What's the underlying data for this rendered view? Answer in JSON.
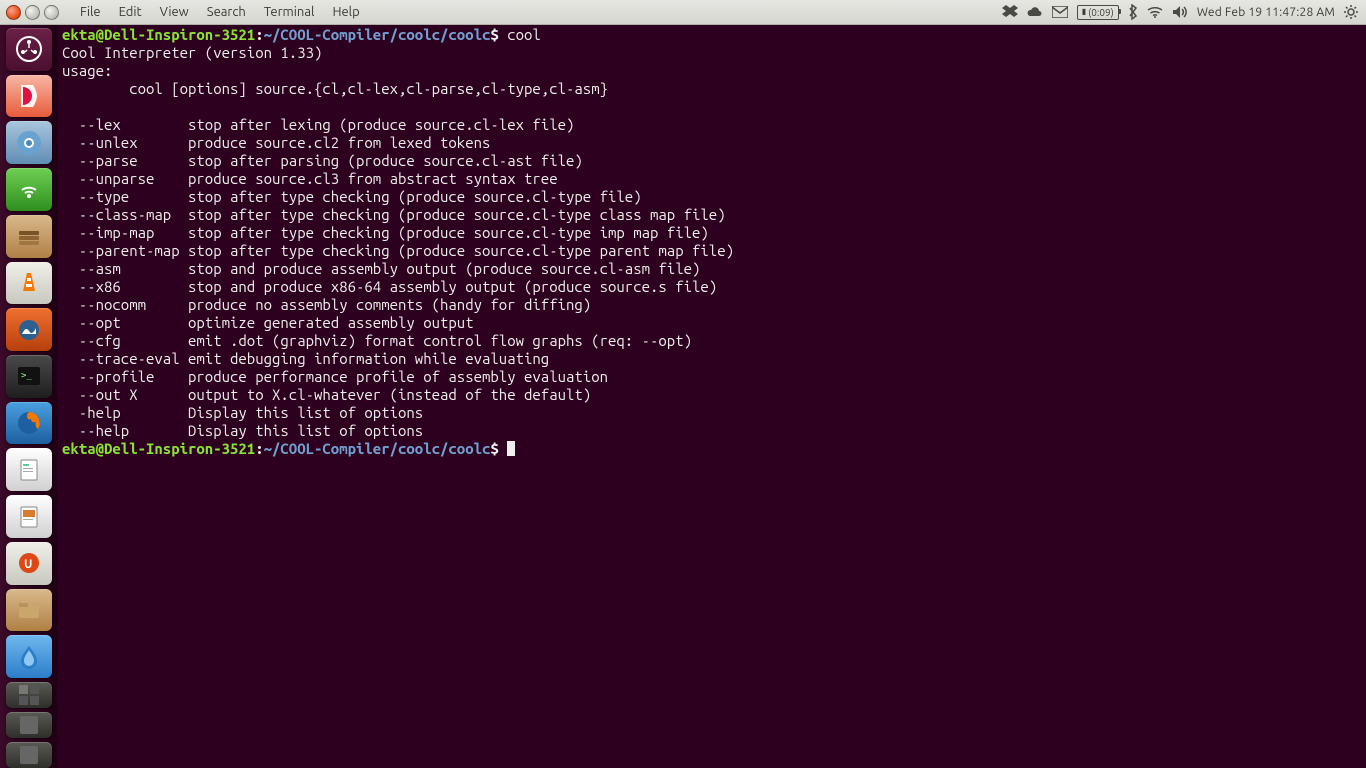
{
  "menubar": {
    "items": [
      "File",
      "Edit",
      "View",
      "Search",
      "Terminal",
      "Help"
    ]
  },
  "tray": {
    "battery": "(0:09)",
    "datetime": "Wed Feb 19  11:47:28 AM"
  },
  "launcher": {
    "items": [
      {
        "name": "dash",
        "color": "linear-gradient(#6b2145,#4b0f30)"
      },
      {
        "name": "evince",
        "color": "linear-gradient(#f7b7a6,#e85b3a)"
      },
      {
        "name": "chromium",
        "color": "linear-gradient(#a9c6dd,#5f8db5)"
      },
      {
        "name": "network",
        "color": "linear-gradient(#6fcf53,#2e8f1e)"
      },
      {
        "name": "files",
        "color": "linear-gradient(#d9b98c,#b08045)"
      },
      {
        "name": "vlc",
        "color": "linear-gradient(#f0efe9,#c9c8bf)"
      },
      {
        "name": "amarok",
        "color": "linear-gradient(#f07030,#b73f0c)"
      },
      {
        "name": "terminal",
        "color": "linear-gradient(#4a4a4a,#1e1e1e)"
      },
      {
        "name": "firefox",
        "color": "linear-gradient(#4aa0e0,#1e5fa0)"
      },
      {
        "name": "libreoffice",
        "color": "linear-gradient(#ffffff,#d0d0d0)"
      },
      {
        "name": "impress",
        "color": "linear-gradient(#ffffff,#d0d0d0)"
      },
      {
        "name": "ubuntuone",
        "color": "linear-gradient(#f0efe9,#c9c8bf)"
      },
      {
        "name": "nautilus2",
        "color": "linear-gradient(#d9b98c,#b08045)"
      },
      {
        "name": "deluge",
        "color": "linear-gradient(#6fb8ef,#2c7ec9)"
      },
      {
        "name": "workspace",
        "color": "linear-gradient(#5a5a55,#2e2e2a)"
      },
      {
        "name": "extra1",
        "color": "linear-gradient(#5a5a55,#2e2e2a)"
      },
      {
        "name": "extra2",
        "color": "linear-gradient(#5a5a55,#2e2e2a)"
      }
    ]
  },
  "terminal": {
    "prompt_user": "ekta@Dell-Inspiron-3521",
    "prompt_sep1": ":",
    "prompt_path": "~/COOL-Compiler/coolc/coolc",
    "prompt_sep2": "$ ",
    "command": "cool",
    "header": "Cool Interpreter (version 1.33)",
    "usage_label": "usage:",
    "usage_line": "        cool [options] source.{cl,cl-lex,cl-parse,cl-type,cl-asm}",
    "options": [
      {
        "flag": "  --lex        ",
        "desc": "stop after lexing (produce source.cl-lex file)"
      },
      {
        "flag": "  --unlex      ",
        "desc": "produce source.cl2 from lexed tokens"
      },
      {
        "flag": "  --parse      ",
        "desc": "stop after parsing (produce source.cl-ast file)"
      },
      {
        "flag": "  --unparse    ",
        "desc": "produce source.cl3 from abstract syntax tree"
      },
      {
        "flag": "  --type       ",
        "desc": "stop after type checking (produce source.cl-type file)"
      },
      {
        "flag": "  --class-map  ",
        "desc": "stop after type checking (produce source.cl-type class map file)"
      },
      {
        "flag": "  --imp-map    ",
        "desc": "stop after type checking (produce source.cl-type imp map file)"
      },
      {
        "flag": "  --parent-map ",
        "desc": "stop after type checking (produce source.cl-type parent map file)"
      },
      {
        "flag": "  --asm        ",
        "desc": "stop and produce assembly output (produce source.cl-asm file)"
      },
      {
        "flag": "  --x86        ",
        "desc": "stop and produce x86-64 assembly output (produce source.s file)"
      },
      {
        "flag": "  --nocomm     ",
        "desc": "produce no assembly comments (handy for diffing)"
      },
      {
        "flag": "  --opt        ",
        "desc": "optimize generated assembly output"
      },
      {
        "flag": "  --cfg        ",
        "desc": "emit .dot (graphviz) format control flow graphs (req: --opt)"
      },
      {
        "flag": "  --trace-eval ",
        "desc": "emit debugging information while evaluating"
      },
      {
        "flag": "  --profile    ",
        "desc": "produce performance profile of assembly evaluation"
      },
      {
        "flag": "  --out X      ",
        "desc": "output to X.cl-whatever (instead of the default)"
      },
      {
        "flag": "  -help        ",
        "desc": "Display this list of options"
      },
      {
        "flag": "  --help       ",
        "desc": "Display this list of options"
      }
    ]
  }
}
